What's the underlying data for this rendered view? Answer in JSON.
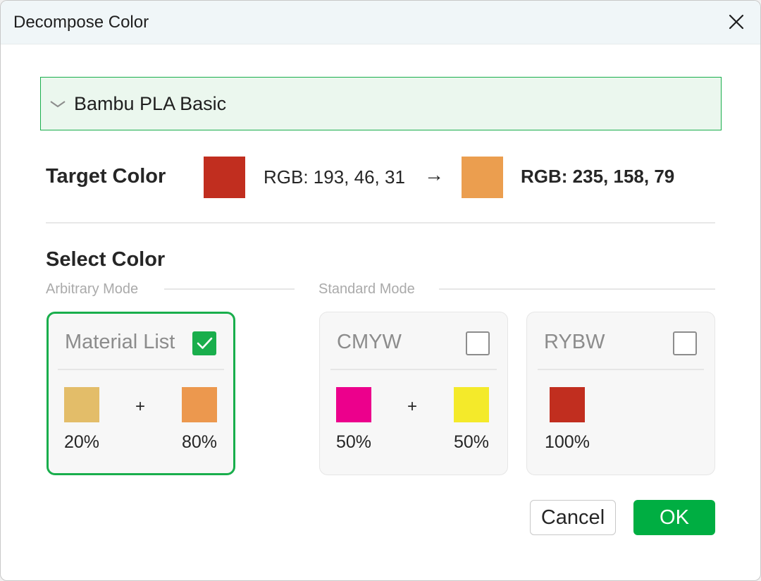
{
  "window": {
    "title": "Decompose Color"
  },
  "material": {
    "selected": "Bambu PLA Basic"
  },
  "target": {
    "label": "Target Color",
    "original_rgb_text": "RGB: 193, 46, 31",
    "original_color": "#c12e1f",
    "arrow": "→",
    "result_rgb_text": "RGB: 235, 158, 79",
    "result_color": "#eb9e4f"
  },
  "select": {
    "label": "Select Color",
    "arbitrary_mode_label": "Arbitrary Mode",
    "standard_mode_label": "Standard Mode"
  },
  "cards": [
    {
      "title": "Material List",
      "checked": true,
      "swatches": [
        {
          "color": "#e3bd69",
          "percent": "20%"
        },
        {
          "color": "#ec984e",
          "percent": "80%"
        }
      ]
    },
    {
      "title": "CMYW",
      "checked": false,
      "swatches": [
        {
          "color": "#ec008c",
          "percent": "50%"
        },
        {
          "color": "#f4ea2a",
          "percent": "50%"
        }
      ]
    },
    {
      "title": "RYBW",
      "checked": false,
      "swatches": [
        {
          "color": "#c12e1f",
          "percent": "100%"
        }
      ]
    }
  ],
  "plus_sign": "+",
  "buttons": {
    "cancel": "Cancel",
    "ok": "OK"
  },
  "colors": {
    "accent": "#00ae42",
    "border_green": "#19ae4c"
  }
}
